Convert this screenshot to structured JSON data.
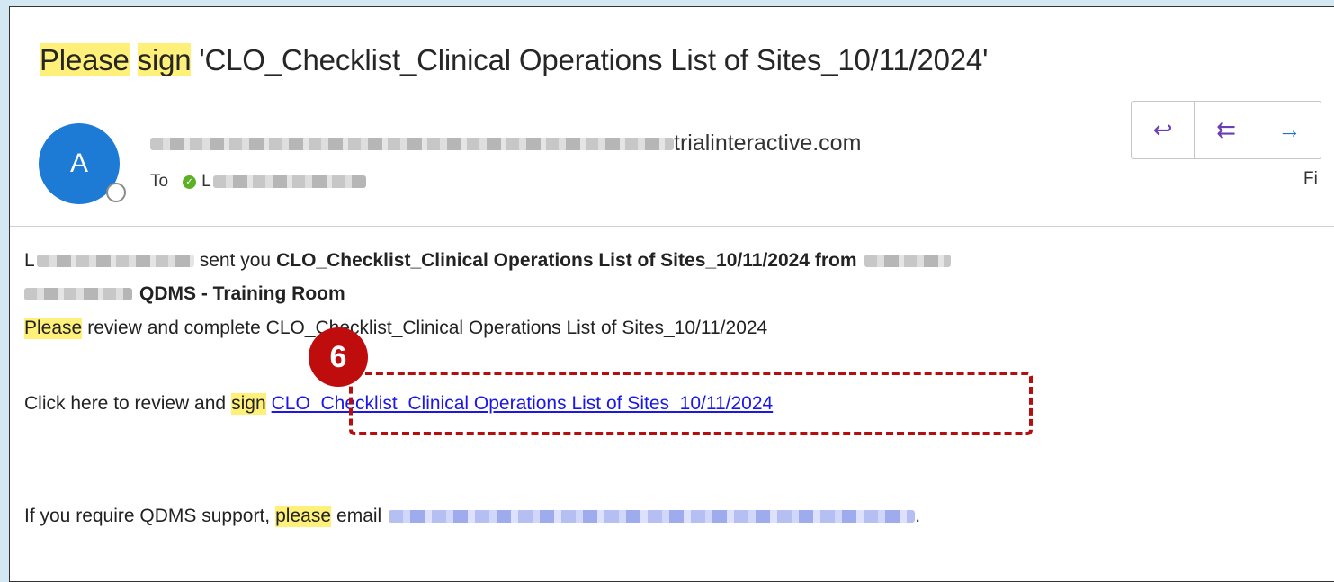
{
  "email": {
    "subject": {
      "highlight_1": "Please",
      "highlight_2": "sign",
      "rest": "'CLO_Checklist_Clinical Operations List of Sites_10/11/2024'"
    },
    "avatar_initial": "A",
    "sender_domain": "trialinteractive.com",
    "to_label": "To",
    "recipient_initial": "L",
    "date_fragment": "Fi",
    "actions": [
      {
        "name": "reply",
        "glyph": "↩"
      },
      {
        "name": "reply-all",
        "glyph": "⇇"
      },
      {
        "name": "forward",
        "glyph": "→"
      }
    ]
  },
  "body": {
    "line1_initial": "L",
    "line1_text": "sent you",
    "line1_doc": "CLO_Checklist_Clinical Operations List of Sites_10/11/2024 from",
    "line2_text": "QDMS - Training Room",
    "line3_hl": "Please",
    "line3_text": "review and complete CLO_Checklist_Clinical Operations List of Sites_10/11/2024",
    "line4_text": "Click here to review and",
    "line4_hl": "sign",
    "line4_link": "CLO_Checklist_Clinical Operations List of Sites_10/11/2024",
    "line5_text": "If you require QDMS support,",
    "line5_hl": "please",
    "line5_text2": "email",
    "line5_end": "."
  },
  "annotation": {
    "step_number": "6",
    "color": "#bf0d0d"
  }
}
